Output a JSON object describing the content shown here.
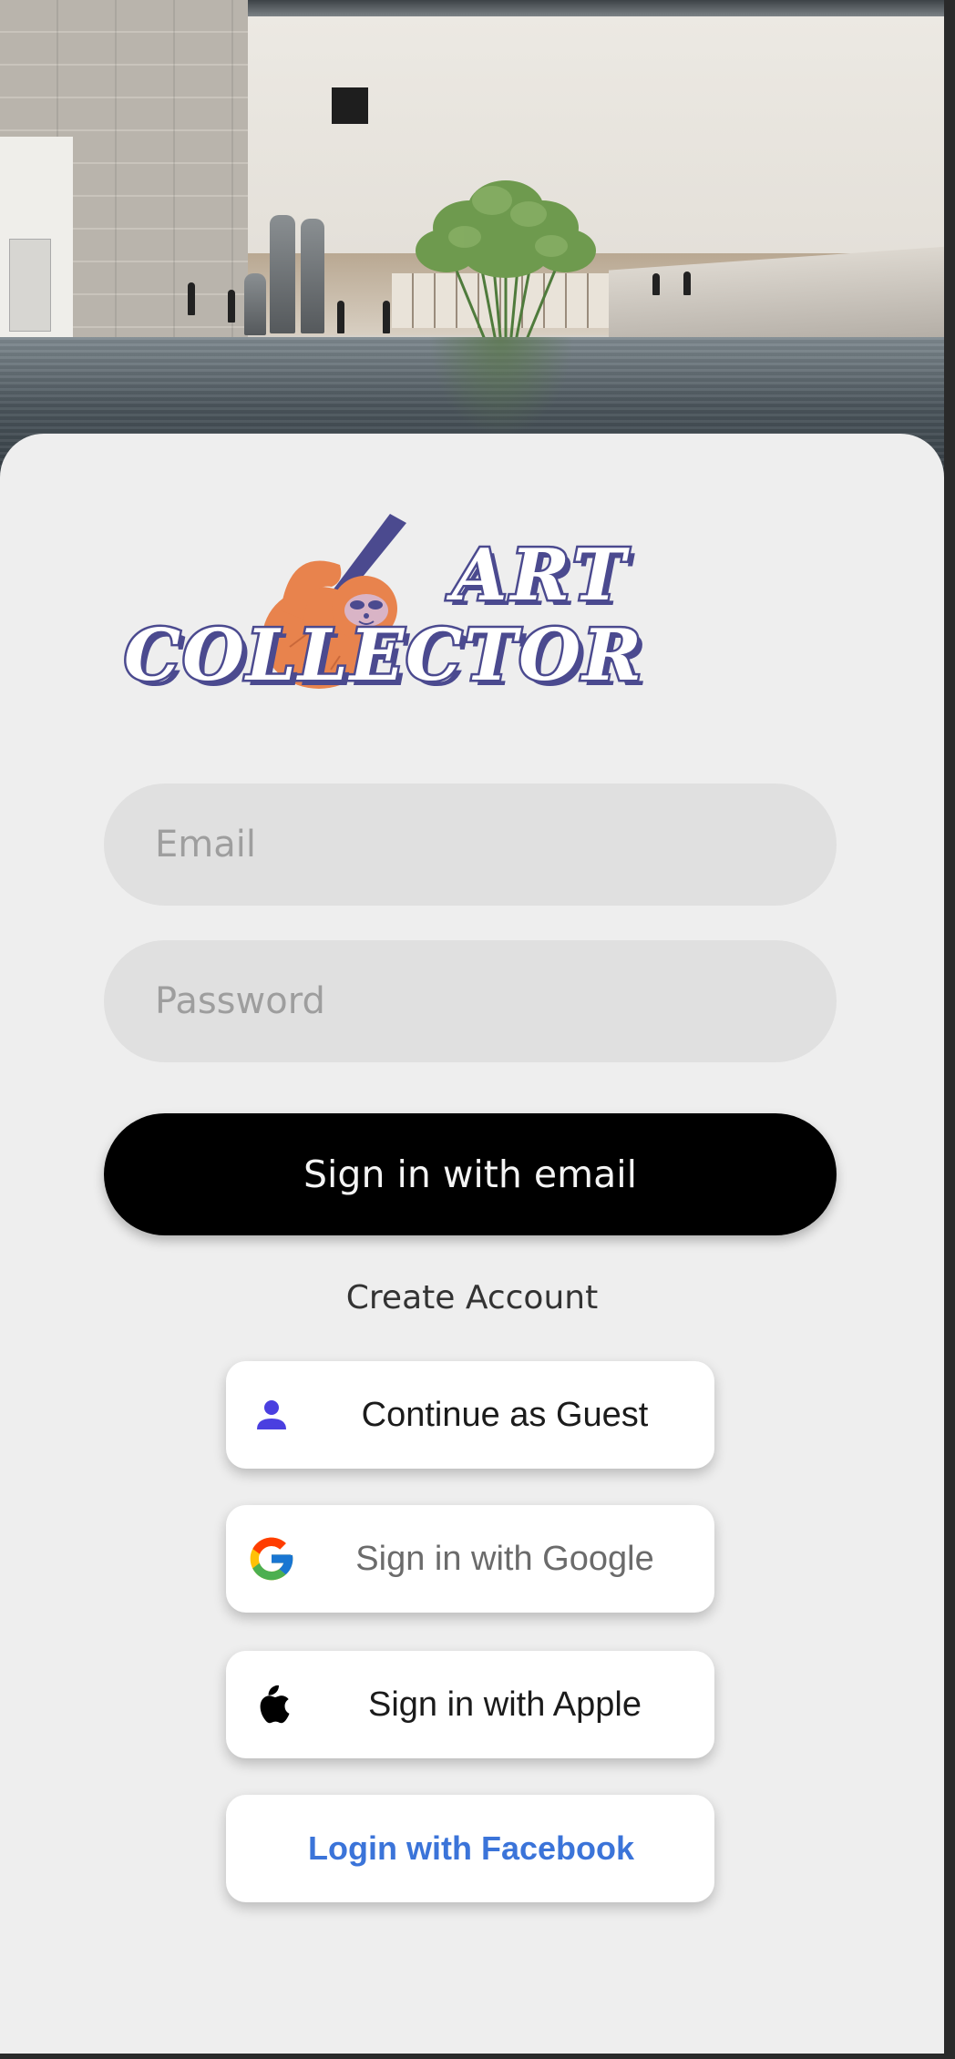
{
  "hero": {
    "image": "museum-gallery-photo"
  },
  "logo": {
    "line1": "ART",
    "line2": "COLLECTOR"
  },
  "form": {
    "email_placeholder": "Email",
    "email_value": "",
    "password_placeholder": "Password",
    "password_value": "",
    "sign_in_label": "Sign in with email",
    "create_account_label": "Create Account"
  },
  "social": {
    "guest_label": "Continue as Guest",
    "google_label": "Sign in with Google",
    "apple_label": "Sign in with Apple",
    "facebook_label": "Login with Facebook"
  },
  "colors": {
    "sheet": "#eeeeee",
    "primary_button": "#000000",
    "logo_ink": "#4b4a8f",
    "logo_mascot": "#e8834d",
    "guest_icon": "#4a3fe0",
    "facebook_text": "#3b74d9"
  },
  "icons": {
    "guest": "person-icon",
    "google": "google-icon",
    "apple": "apple-icon"
  }
}
